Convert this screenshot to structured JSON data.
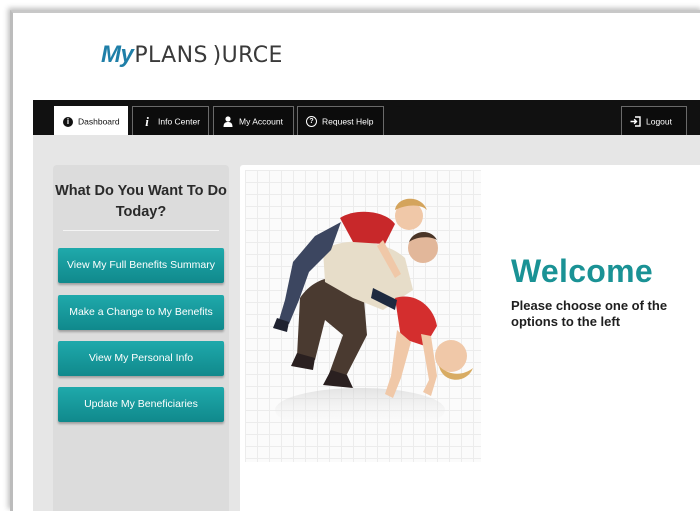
{
  "brand": {
    "prefix": "My",
    "name": "PLANS )URCE"
  },
  "nav": {
    "tabs": [
      {
        "label": "Dashboard",
        "icon": "info-circle-icon",
        "active": true
      },
      {
        "label": "Info Center",
        "icon": "info-icon",
        "active": false
      },
      {
        "label": "My Account",
        "icon": "user-icon",
        "active": false
      },
      {
        "label": "Request Help",
        "icon": "help-circle-icon",
        "active": false
      }
    ],
    "logout": {
      "label": "Logout",
      "icon": "logout-icon"
    }
  },
  "sidebar": {
    "heading": "What Do You Want To Do Today?",
    "buttons": [
      "View My Full Benefits Summary",
      "Make a Change to My Benefits",
      "View My Personal Info",
      "Update My Beneficiaries"
    ]
  },
  "main": {
    "welcome": "Welcome",
    "instruction": "Please choose one of the options to the left"
  },
  "colors": {
    "accent": "#1a9295",
    "button": "#15999b",
    "navbar": "#111111",
    "brand_blue": "#1f7fa8"
  }
}
